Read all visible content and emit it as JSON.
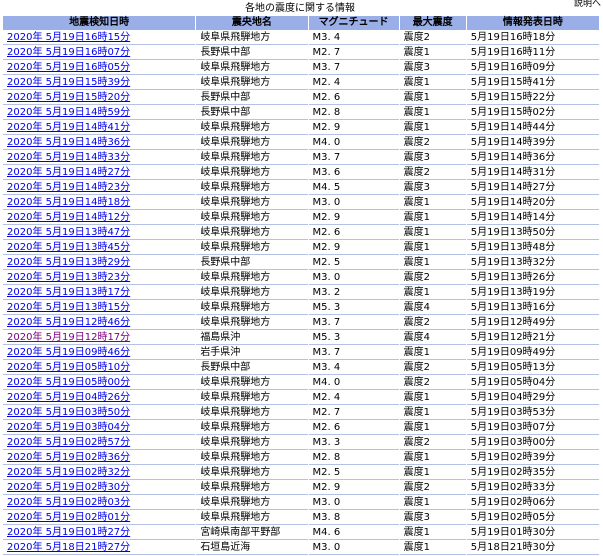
{
  "caption": "各地の震度に関する情報",
  "explain_link": "説明へ",
  "columns": [
    "地震検知日時",
    "震央地名",
    "マグニチュード",
    "最大震度",
    "情報発表日時"
  ],
  "rows": [
    {
      "time": "2020年 5月19日16時15分",
      "epicenter": "岐阜県飛騨地方",
      "mag": "M3. 4",
      "max": "震度2",
      "issued": "5月19日16時18分"
    },
    {
      "time": "2020年 5月19日16時07分",
      "epicenter": "長野県中部",
      "mag": "M2. 7",
      "max": "震度1",
      "issued": "5月19日16時11分"
    },
    {
      "time": "2020年 5月19日16時05分",
      "epicenter": "岐阜県飛騨地方",
      "mag": "M3. 7",
      "max": "震度3",
      "issued": "5月19日16時09分"
    },
    {
      "time": "2020年 5月19日15時39分",
      "epicenter": "岐阜県飛騨地方",
      "mag": "M2. 4",
      "max": "震度1",
      "issued": "5月19日15時41分"
    },
    {
      "time": "2020年 5月19日15時20分",
      "epicenter": "長野県中部",
      "mag": "M2. 6",
      "max": "震度1",
      "issued": "5月19日15時22分"
    },
    {
      "time": "2020年 5月19日14時59分",
      "epicenter": "長野県中部",
      "mag": "M2. 8",
      "max": "震度1",
      "issued": "5月19日15時02分"
    },
    {
      "time": "2020年 5月19日14時41分",
      "epicenter": "岐阜県飛騨地方",
      "mag": "M2. 9",
      "max": "震度1",
      "issued": "5月19日14時44分"
    },
    {
      "time": "2020年 5月19日14時36分",
      "epicenter": "岐阜県飛騨地方",
      "mag": "M4. 0",
      "max": "震度2",
      "issued": "5月19日14時39分"
    },
    {
      "time": "2020年 5月19日14時33分",
      "epicenter": "岐阜県飛騨地方",
      "mag": "M3. 7",
      "max": "震度3",
      "issued": "5月19日14時36分"
    },
    {
      "time": "2020年 5月19日14時27分",
      "epicenter": "岐阜県飛騨地方",
      "mag": "M3. 6",
      "max": "震度2",
      "issued": "5月19日14時31分"
    },
    {
      "time": "2020年 5月19日14時23分",
      "epicenter": "岐阜県飛騨地方",
      "mag": "M4. 5",
      "max": "震度3",
      "issued": "5月19日14時27分"
    },
    {
      "time": "2020年 5月19日14時18分",
      "epicenter": "岐阜県飛騨地方",
      "mag": "M3. 0",
      "max": "震度1",
      "issued": "5月19日14時20分"
    },
    {
      "time": "2020年 5月19日14時12分",
      "epicenter": "岐阜県飛騨地方",
      "mag": "M2. 9",
      "max": "震度1",
      "issued": "5月19日14時14分"
    },
    {
      "time": "2020年 5月19日13時47分",
      "epicenter": "岐阜県飛騨地方",
      "mag": "M2. 6",
      "max": "震度1",
      "issued": "5月19日13時50分"
    },
    {
      "time": "2020年 5月19日13時45分",
      "epicenter": "岐阜県飛騨地方",
      "mag": "M2. 9",
      "max": "震度1",
      "issued": "5月19日13時48分"
    },
    {
      "time": "2020年 5月19日13時29分",
      "epicenter": "長野県中部",
      "mag": "M2. 5",
      "max": "震度1",
      "issued": "5月19日13時32分"
    },
    {
      "time": "2020年 5月19日13時23分",
      "epicenter": "岐阜県飛騨地方",
      "mag": "M3. 0",
      "max": "震度2",
      "issued": "5月19日13時26分"
    },
    {
      "time": "2020年 5月19日13時17分",
      "epicenter": "岐阜県飛騨地方",
      "mag": "M3. 2",
      "max": "震度1",
      "issued": "5月19日13時19分"
    },
    {
      "time": "2020年 5月19日13時15分",
      "epicenter": "岐阜県飛騨地方",
      "mag": "M5. 3",
      "max": "震度4",
      "issued": "5月19日13時16分"
    },
    {
      "time": "2020年 5月19日12時46分",
      "epicenter": "岐阜県飛騨地方",
      "mag": "M3. 7",
      "max": "震度2",
      "issued": "5月19日12時49分"
    },
    {
      "time": "2020年 5月19日12時17分",
      "epicenter": "福島県沖",
      "mag": "M5. 3",
      "max": "震度4",
      "issued": "5月19日12時21分",
      "visited": true
    },
    {
      "time": "2020年 5月19日09時46分",
      "epicenter": "岩手県沖",
      "mag": "M3. 7",
      "max": "震度1",
      "issued": "5月19日09時49分"
    },
    {
      "time": "2020年 5月19日05時10分",
      "epicenter": "長野県中部",
      "mag": "M3. 4",
      "max": "震度2",
      "issued": "5月19日05時13分"
    },
    {
      "time": "2020年 5月19日05時00分",
      "epicenter": "岐阜県飛騨地方",
      "mag": "M4. 0",
      "max": "震度2",
      "issued": "5月19日05時04分"
    },
    {
      "time": "2020年 5月19日04時26分",
      "epicenter": "岐阜県飛騨地方",
      "mag": "M2. 4",
      "max": "震度1",
      "issued": "5月19日04時29分"
    },
    {
      "time": "2020年 5月19日03時50分",
      "epicenter": "岐阜県飛騨地方",
      "mag": "M2. 7",
      "max": "震度1",
      "issued": "5月19日03時53分"
    },
    {
      "time": "2020年 5月19日03時04分",
      "epicenter": "岐阜県飛騨地方",
      "mag": "M2. 6",
      "max": "震度1",
      "issued": "5月19日03時07分"
    },
    {
      "time": "2020年 5月19日02時57分",
      "epicenter": "岐阜県飛騨地方",
      "mag": "M3. 3",
      "max": "震度2",
      "issued": "5月19日03時00分"
    },
    {
      "time": "2020年 5月19日02時36分",
      "epicenter": "岐阜県飛騨地方",
      "mag": "M2. 8",
      "max": "震度1",
      "issued": "5月19日02時39分"
    },
    {
      "time": "2020年 5月19日02時32分",
      "epicenter": "岐阜県飛騨地方",
      "mag": "M2. 5",
      "max": "震度1",
      "issued": "5月19日02時35分"
    },
    {
      "time": "2020年 5月19日02時30分",
      "epicenter": "岐阜県飛騨地方",
      "mag": "M2. 9",
      "max": "震度2",
      "issued": "5月19日02時33分"
    },
    {
      "time": "2020年 5月19日02時03分",
      "epicenter": "岐阜県飛騨地方",
      "mag": "M3. 0",
      "max": "震度1",
      "issued": "5月19日02時06分"
    },
    {
      "time": "2020年 5月19日02時01分",
      "epicenter": "岐阜県飛騨地方",
      "mag": "M3. 8",
      "max": "震度3",
      "issued": "5月19日02時05分"
    },
    {
      "time": "2020年 5月19日01時27分",
      "epicenter": "宮崎県南部平野部",
      "mag": "M4. 6",
      "max": "震度1",
      "issued": "5月19日01時30分"
    },
    {
      "time": "2020年 5月18日21時27分",
      "epicenter": "石垣島近海",
      "mag": "M3. 0",
      "max": "震度1",
      "issued": "5月18日21時30分"
    }
  ]
}
